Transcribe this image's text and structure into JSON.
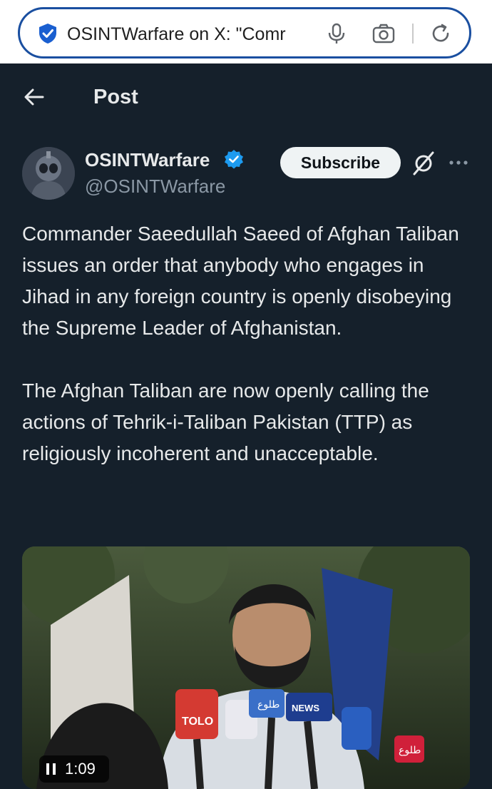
{
  "browser": {
    "url_text": "OSINTWarfare on X: \"Comr",
    "icons": [
      "shield-icon",
      "mic-icon",
      "camera-icon",
      "reload-icon"
    ]
  },
  "header": {
    "back_icon": "arrow-left-icon",
    "title": "Post"
  },
  "author": {
    "name": "OSINTWarfare",
    "handle": "@OSINTWarfare",
    "verified_color": "#1d9bf0",
    "subscribe_label": "Subscribe"
  },
  "tweet": {
    "paragraphs": [
      "Commander Saeedullah Saeed of Afghan Taliban issues an order that anybody who engages in Jihad in any foreign country is openly disobeying the Supreme Leader of Afghanistan.",
      "The Afghan Taliban are now openly calling the actions of Tehrik-i-Taliban Pakistan (TTP) as religiously incoherent and unacceptable."
    ]
  },
  "media": {
    "duration": "1:09",
    "state_icon": "pause-icon",
    "mic_labels": [
      "TOLO",
      "طلوع",
      "NEWS",
      "طلوع"
    ]
  },
  "colors": {
    "background": "#15202b",
    "text": "#e7e9ea",
    "secondary_text": "#8b98a5",
    "accent": "#1d9bf0"
  }
}
